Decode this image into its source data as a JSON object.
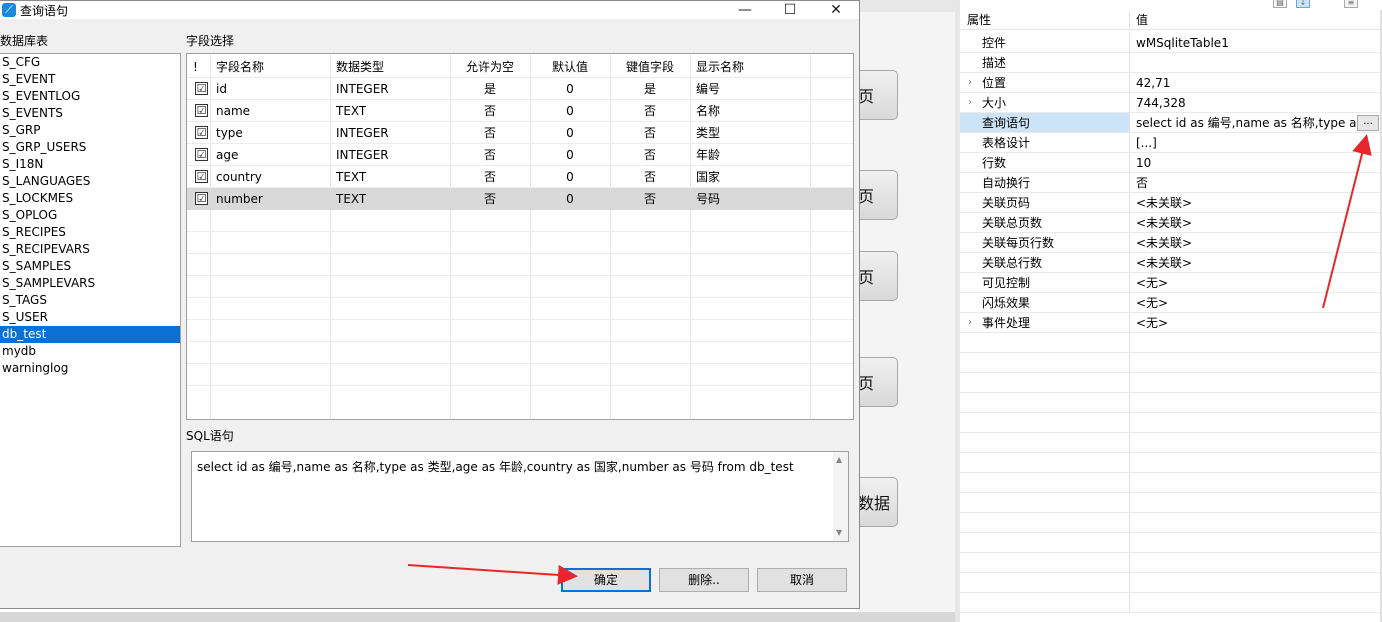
{
  "dialog": {
    "title": "查询语句",
    "db_list_label": "数据库表",
    "fields_label": "字段选择",
    "sql_label": "SQL语句",
    "db_tables": [
      "S_CFG",
      "S_EVENT",
      "S_EVENTLOG",
      "S_EVENTS",
      "S_GRP",
      "S_GRP_USERS",
      "S_I18N",
      "S_LANGUAGES",
      "S_LOCKMES",
      "S_OPLOG",
      "S_RECIPES",
      "S_RECIPEVARS",
      "S_SAMPLES",
      "S_SAMPLEVARS",
      "S_TAGS",
      "S_USER",
      "db_test",
      "mydb",
      "warninglog"
    ],
    "selected_table_index": 16,
    "grid": {
      "columns": [
        "!",
        "字段名称",
        "数据类型",
        "允许为空",
        "默认值",
        "键值字段",
        "显示名称"
      ],
      "rows": [
        {
          "checked": "☑",
          "name": "id",
          "type": "INTEGER",
          "nullable": "是",
          "default": "0",
          "key": "是",
          "display": "编号"
        },
        {
          "checked": "☑",
          "name": "name",
          "type": "TEXT",
          "nullable": "否",
          "default": "0",
          "key": "否",
          "display": "名称"
        },
        {
          "checked": "☑",
          "name": "type",
          "type": "INTEGER",
          "nullable": "否",
          "default": "0",
          "key": "否",
          "display": "类型"
        },
        {
          "checked": "☑",
          "name": "age",
          "type": "INTEGER",
          "nullable": "否",
          "default": "0",
          "key": "否",
          "display": "年龄"
        },
        {
          "checked": "☑",
          "name": "country",
          "type": "TEXT",
          "nullable": "否",
          "default": "0",
          "key": "否",
          "display": "国家"
        },
        {
          "checked": "☑",
          "name": "number",
          "type": "TEXT",
          "nullable": "否",
          "default": "0",
          "key": "否",
          "display": "号码"
        }
      ],
      "selected_row_index": 5
    },
    "sql_text": "select id as 编号,name as 名称,type as 类型,age as 年龄,country as 国家,number as 号码 from db_test",
    "buttons": {
      "ok": "确定",
      "delete": "删除..",
      "cancel": "取消"
    }
  },
  "background": {
    "button_labels": [
      "页",
      "页",
      "页",
      "页",
      "数据"
    ]
  },
  "properties": {
    "header": {
      "name": "属性",
      "value": "值"
    },
    "rows": [
      {
        "name": "控件",
        "value": "wMSqliteTable1",
        "expand": ""
      },
      {
        "name": "描述",
        "value": "",
        "expand": ""
      },
      {
        "name": "位置",
        "value": "42,71",
        "expand": "›"
      },
      {
        "name": "大小",
        "value": "744,328",
        "expand": "›"
      },
      {
        "name": "查询语句",
        "value": "select id as 编号,name as 名称,type as 类",
        "expand": ""
      },
      {
        "name": "表格设计",
        "value": "[...]",
        "expand": ""
      },
      {
        "name": "行数",
        "value": "10",
        "expand": ""
      },
      {
        "name": "自动换行",
        "value": "否",
        "expand": ""
      },
      {
        "name": "关联页码",
        "value": "<未关联>",
        "expand": ""
      },
      {
        "name": "关联总页数",
        "value": "<未关联>",
        "expand": ""
      },
      {
        "name": "关联每页行数",
        "value": "<未关联>",
        "expand": ""
      },
      {
        "name": "关联总行数",
        "value": "<未关联>",
        "expand": ""
      },
      {
        "name": "可见控制",
        "value": "<无>",
        "expand": ""
      },
      {
        "name": "闪烁效果",
        "value": "<无>",
        "expand": ""
      },
      {
        "name": "事件处理",
        "value": "<无>",
        "expand": "›"
      }
    ],
    "selected_row_index": 4,
    "ellipsis_label": "..."
  },
  "colors": {
    "accent": "#0a70d4",
    "annotation_arrow": "#e8262b",
    "selection_grey": "#d9d9d9",
    "prop_selected": "#cce4f7"
  }
}
